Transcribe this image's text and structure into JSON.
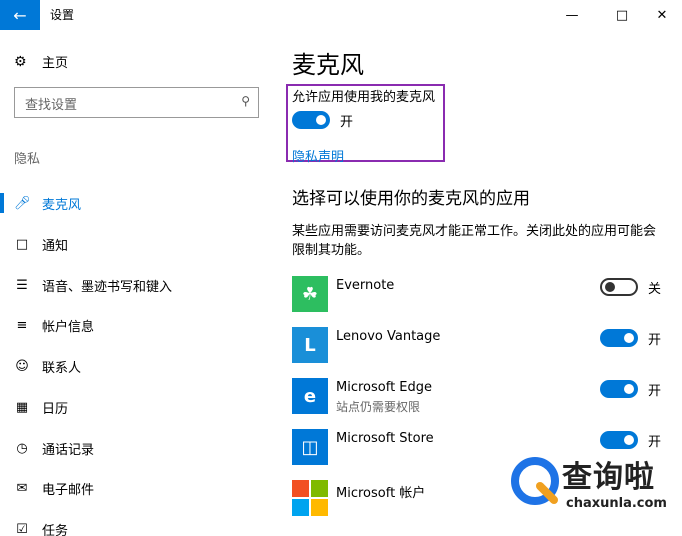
{
  "window": {
    "title": "设置"
  },
  "sidebar": {
    "home_label": "主页",
    "search_placeholder": "查找设置",
    "section_label": "隐私",
    "items": [
      {
        "label": "麦克风",
        "icon": "microphone-icon",
        "active": true
      },
      {
        "label": "通知",
        "icon": "notification-icon"
      },
      {
        "label": "语音、墨迹书写和键入",
        "icon": "clipboard-icon"
      },
      {
        "label": "帐户信息",
        "icon": "account-info-icon"
      },
      {
        "label": "联系人",
        "icon": "contacts-icon"
      },
      {
        "label": "日历",
        "icon": "calendar-icon"
      },
      {
        "label": "通话记录",
        "icon": "call-history-icon"
      },
      {
        "label": "电子邮件",
        "icon": "email-icon"
      },
      {
        "label": "任务",
        "icon": "tasks-icon"
      }
    ]
  },
  "main": {
    "title": "麦克风",
    "allow_label": "允许应用使用我的麦克风",
    "allow_toggle_text": "开",
    "privacy_link": "隐私声明",
    "section_title": "选择可以使用你的麦克风的应用",
    "description": "某些应用需要访问麦克风才能正常工作。关闭此处的应用可能会限制其功能。",
    "apps": [
      {
        "name": "Evernote",
        "sub": "",
        "state": "关",
        "on": false,
        "color": "#2dbe60"
      },
      {
        "name": "Lenovo Vantage",
        "sub": "",
        "state": "开",
        "on": true,
        "color": "#1a8fd8"
      },
      {
        "name": "Microsoft Edge",
        "sub": "站点仍需要权限",
        "state": "开",
        "on": true,
        "color": "#0078d7"
      },
      {
        "name": "Microsoft Store",
        "sub": "",
        "state": "开",
        "on": true,
        "color": "#0078d7"
      },
      {
        "name": "Microsoft 帐户",
        "sub": "",
        "state": "",
        "on": null,
        "color": "#f25022"
      }
    ]
  },
  "watermark": {
    "name": "查询啦",
    "url": "chaxunla.com"
  },
  "colors": {
    "accent": "#0078d7",
    "highlight": "#8a2bb0"
  }
}
